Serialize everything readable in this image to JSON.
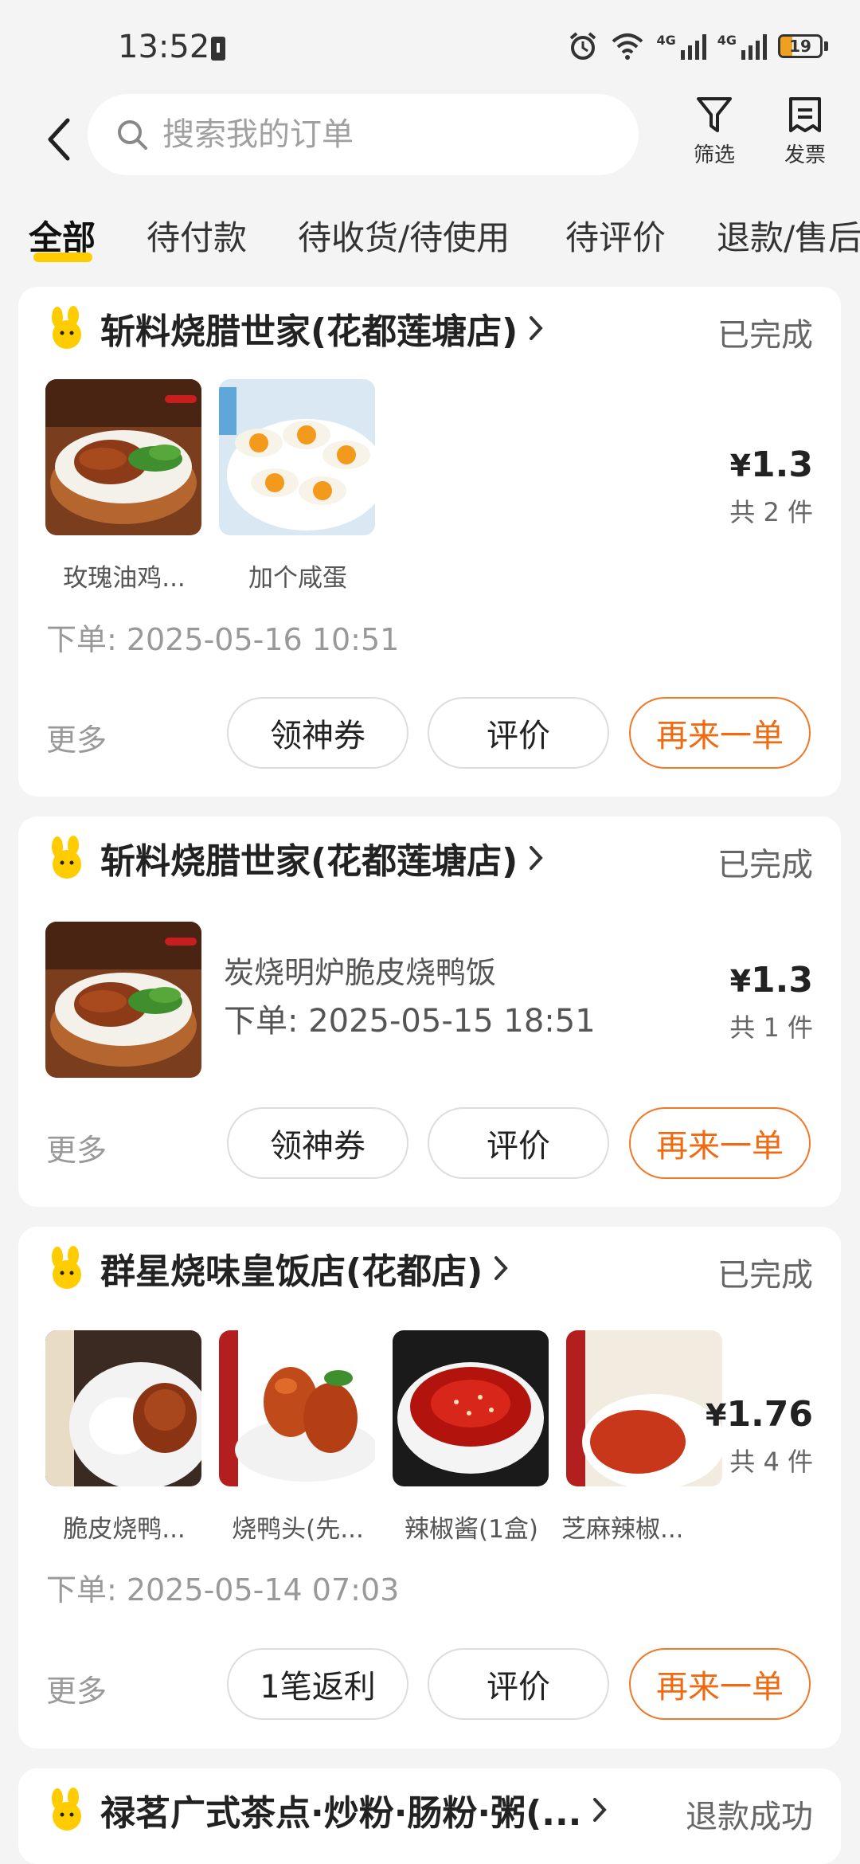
{
  "status_bar": {
    "time": "13:52",
    "network_1": "4G",
    "network_2": "4G",
    "battery": "19"
  },
  "header": {
    "search_placeholder": "搜索我的订单",
    "filter_label": "筛选",
    "invoice_label": "发票"
  },
  "tabs": [
    {
      "label": "全部",
      "active": true
    },
    {
      "label": "待付款",
      "active": false
    },
    {
      "label": "待收货/待使用",
      "active": false
    },
    {
      "label": "待评价",
      "active": false
    },
    {
      "label": "退款/售后",
      "active": false
    }
  ],
  "colors": {
    "accent": "#ffcc00",
    "action_orange": "#ef6a12"
  },
  "orders": [
    {
      "shop": "斩料烧腊世家(花都莲塘店)",
      "status": "已完成",
      "items": [
        {
          "label": "玫瑰油鸡...",
          "image": "rose-oil-chicken-rice-image"
        },
        {
          "label": "加个咸蛋",
          "image": "salted-egg-image"
        }
      ],
      "price": "1.3",
      "currency": "¥",
      "count": "共 2 件",
      "time": "下单: 2025-05-16 10:51",
      "more": "更多",
      "buttons": [
        "领神券",
        "评价",
        "再来一单"
      ]
    },
    {
      "shop": "斩料烧腊世家(花都莲塘店)",
      "status": "已完成",
      "item_name": "炭烧明炉脆皮烧鸭饭",
      "time": "下单: 2025-05-15 18:51",
      "price": "1.3",
      "currency": "¥",
      "count": "共 1 件",
      "more": "更多",
      "buttons": [
        "领神券",
        "评价",
        "再来一单"
      ]
    },
    {
      "shop": "群星烧味皇饭店(花都店)",
      "status": "已完成",
      "items": [
        {
          "label": "脆皮烧鸭...",
          "image": "roast-duck-rice-image"
        },
        {
          "label": "烧鸭头(先...",
          "image": "roast-duck-head-image"
        },
        {
          "label": "辣椒酱(1盒)",
          "image": "chili-sauce-image"
        },
        {
          "label": "芝麻辣椒...",
          "image": "sesame-chili-image"
        }
      ],
      "price": "1.76",
      "currency": "¥",
      "count": "共 4 件",
      "time": "下单: 2025-05-14 07:03",
      "more": "更多",
      "buttons": [
        "1笔返利",
        "评价",
        "再来一单"
      ]
    },
    {
      "shop": "禄茗广式茶点·炒粉·肠粉·粥(...",
      "status": "退款成功"
    }
  ]
}
